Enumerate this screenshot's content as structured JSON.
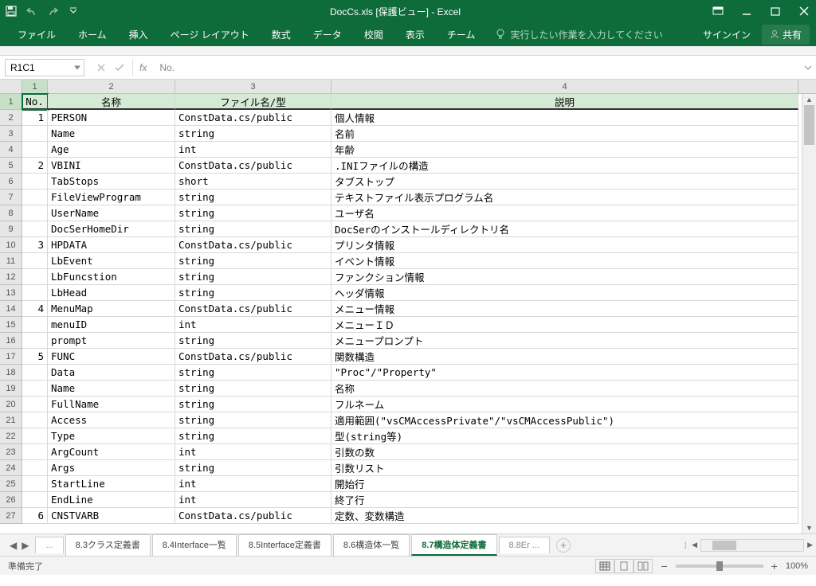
{
  "app": {
    "title": "DocCs.xls  [保護ビュー] - Excel",
    "signin": "サインイン",
    "share": "共有"
  },
  "ribbon": {
    "tabs": [
      "ファイル",
      "ホーム",
      "挿入",
      "ページ レイアウト",
      "数式",
      "データ",
      "校閲",
      "表示",
      "チーム"
    ],
    "tellme": "実行したい作業を入力してください"
  },
  "formula": {
    "namebox": "R1C1",
    "value": "No."
  },
  "columns": [
    "1",
    "2",
    "3",
    "4"
  ],
  "header_row": {
    "no": "No.",
    "name": "名称",
    "file": "ファイル名/型",
    "desc": "説明"
  },
  "rows": [
    {
      "r": "2",
      "no": "1",
      "name": "PERSON",
      "file": "ConstData.cs/public",
      "desc": "個人情報"
    },
    {
      "r": "3",
      "no": "",
      "name": "Name",
      "file": "string",
      "desc": "名前"
    },
    {
      "r": "4",
      "no": "",
      "name": "Age",
      "file": "int",
      "desc": "年齢"
    },
    {
      "r": "5",
      "no": "2",
      "name": "VBINI",
      "file": "ConstData.cs/public",
      "desc": ".INIファイルの構造"
    },
    {
      "r": "6",
      "no": "",
      "name": "TabStops",
      "file": "short",
      "desc": "タブストップ"
    },
    {
      "r": "7",
      "no": "",
      "name": "FileViewProgram",
      "file": "string",
      "desc": "テキストファイル表示プログラム名"
    },
    {
      "r": "8",
      "no": "",
      "name": "UserName",
      "file": "string",
      "desc": "ユーザ名"
    },
    {
      "r": "9",
      "no": "",
      "name": "DocSerHomeDir",
      "file": "string",
      "desc": "DocSerのインストールディレクトリ名"
    },
    {
      "r": "10",
      "no": "3",
      "name": "HPDATA",
      "file": "ConstData.cs/public",
      "desc": "プリンタ情報"
    },
    {
      "r": "11",
      "no": "",
      "name": "LbEvent",
      "file": "string",
      "desc": "イベント情報"
    },
    {
      "r": "12",
      "no": "",
      "name": "LbFuncstion",
      "file": "string",
      "desc": "ファンクション情報"
    },
    {
      "r": "13",
      "no": "",
      "name": "LbHead",
      "file": "string",
      "desc": "ヘッダ情報"
    },
    {
      "r": "14",
      "no": "4",
      "name": "MenuMap",
      "file": "ConstData.cs/public",
      "desc": "メニュー情報"
    },
    {
      "r": "15",
      "no": "",
      "name": "menuID",
      "file": "int",
      "desc": "メニューＩＤ"
    },
    {
      "r": "16",
      "no": "",
      "name": "prompt",
      "file": "string",
      "desc": "メニュープロンプト"
    },
    {
      "r": "17",
      "no": "5",
      "name": "FUNC",
      "file": "ConstData.cs/public",
      "desc": "関数構造"
    },
    {
      "r": "18",
      "no": "",
      "name": "Data",
      "file": "string",
      "desc": "\"Proc\"/\"Property\""
    },
    {
      "r": "19",
      "no": "",
      "name": "Name",
      "file": "string",
      "desc": "名称"
    },
    {
      "r": "20",
      "no": "",
      "name": "FullName",
      "file": "string",
      "desc": "フルネーム"
    },
    {
      "r": "21",
      "no": "",
      "name": "Access",
      "file": "string",
      "desc": "適用範囲(\"vsCMAccessPrivate\"/\"vsCMAccessPublic\")"
    },
    {
      "r": "22",
      "no": "",
      "name": "Type",
      "file": "string",
      "desc": "型(string等)"
    },
    {
      "r": "23",
      "no": "",
      "name": "ArgCount",
      "file": "int",
      "desc": "引数の数"
    },
    {
      "r": "24",
      "no": "",
      "name": "Args",
      "file": "string",
      "desc": "引数リスト"
    },
    {
      "r": "25",
      "no": "",
      "name": "StartLine",
      "file": "int",
      "desc": "開始行"
    },
    {
      "r": "26",
      "no": "",
      "name": "EndLine",
      "file": "int",
      "desc": "終了行"
    },
    {
      "r": "27",
      "no": "6",
      "name": "CNSTVARB",
      "file": "ConstData.cs/public",
      "desc": "定数、変数構造"
    }
  ],
  "sheets": {
    "left_trunc": "...",
    "tabs": [
      "8.3クラス定義書",
      "8.4Interface一覧",
      "8.5Interface定義書",
      "8.6構造体一覧",
      "8.7構造体定義書"
    ],
    "right_trunc": "8.8Er ...",
    "active_index": 4
  },
  "status": {
    "ready": "準備完了",
    "zoom": "100%"
  }
}
